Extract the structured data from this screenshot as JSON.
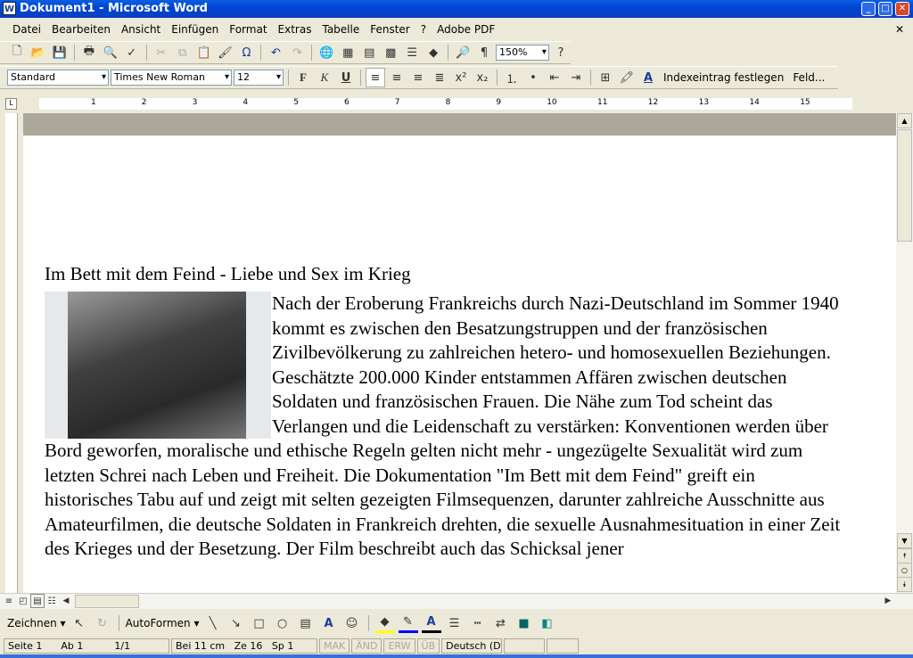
{
  "window": {
    "title": "Dokument1 - Microsoft Word"
  },
  "menu": [
    "Datei",
    "Bearbeiten",
    "Ansicht",
    "Einfügen",
    "Format",
    "Extras",
    "Tabelle",
    "Fenster",
    "?",
    "Adobe PDF"
  ],
  "standard_toolbar": {
    "zoom": "150%"
  },
  "format_toolbar": {
    "style": "Standard",
    "font": "Times New Roman",
    "size": "12",
    "bold": "F",
    "italic": "K",
    "underline": "U",
    "index_entry": "Indexeintrag festlegen",
    "field": "Feld..."
  },
  "ruler": {
    "ticks": [
      "1",
      "2",
      "3",
      "4",
      "5",
      "6",
      "7",
      "8",
      "9",
      "10",
      "11",
      "12",
      "13",
      "14",
      "15"
    ]
  },
  "document": {
    "title": "Im Bett mit dem Feind - Liebe und Sex im Krieg",
    "body": "Nach der Eroberung Frankreichs durch Nazi-Deutschland im Sommer 1940 kommt es zwischen den Besatzungstruppen und der französischen Zivilbevölkerung zu zahlreichen hetero- und homosexuellen Beziehungen. Geschätzte 200.000 Kinder entstammen Affären zwischen deutschen Soldaten und französischen Frauen. Die Nähe zum Tod scheint das Verlangen und die Leidenschaft zu verstärken: Konventionen werden über Bord geworfen, moralische und ethische Regeln gelten nicht mehr - ungezügelte Sexualität wird zum letzten Schrei nach Leben und Freiheit. Die Dokumentation \"Im Bett mit dem Feind\" greift ein historisches Tabu auf und zeigt mit selten gezeigten Filmsequenzen, darunter zahlreiche Ausschnitte aus Amateurfilmen, die deutsche Soldaten in Frankreich drehten, die sexuelle Ausnahmesituation in einer Zeit des Krieges und der Besetzung. Der Film beschreibt auch das Schicksal jener"
  },
  "drawing_toolbar": {
    "draw": "Zeichnen",
    "autoshapes": "AutoFormen"
  },
  "status": {
    "page": "Seite 1",
    "section": "Ab 1",
    "pages": "1/1",
    "at": "Bei 11 cm",
    "line": "Ze 16",
    "col": "Sp 1",
    "rec": "MAK",
    "trk": "ÄND",
    "ext": "ERW",
    "ovr": "ÜB",
    "lang": "Deutsch (De"
  }
}
